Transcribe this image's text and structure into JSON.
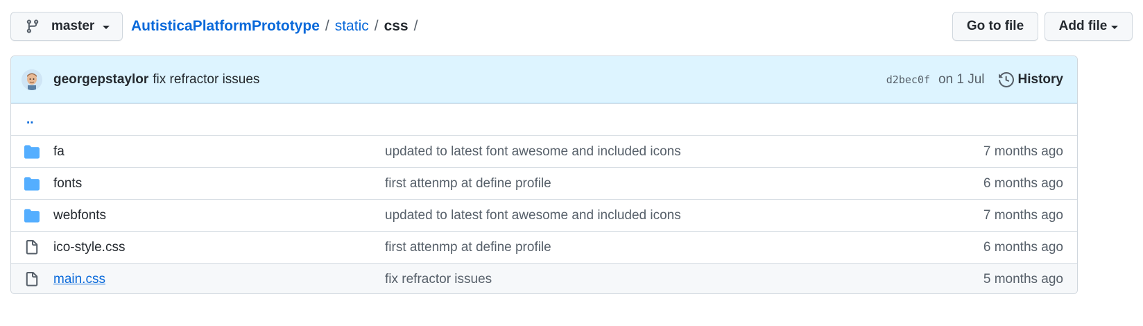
{
  "branch": {
    "name": "master",
    "icon": "git-branch-icon"
  },
  "breadcrumb": {
    "repo": "AutisticaPlatformPrototype",
    "sep": "/",
    "path": [
      "static",
      "css"
    ]
  },
  "actions": {
    "go_to_file": "Go to file",
    "add_file": "Add file"
  },
  "commit": {
    "author": "georgepstaylor",
    "message": "fix refractor issues",
    "sha": "d2bec0f",
    "date": "on 1 Jul",
    "history_label": "History"
  },
  "parent_link": "..",
  "files": [
    {
      "type": "folder",
      "name": "fa",
      "message": "updated to latest font awesome and included icons",
      "age": "7 months ago"
    },
    {
      "type": "folder",
      "name": "fonts",
      "message": "first attenmp at define profile",
      "age": "6 months ago"
    },
    {
      "type": "folder",
      "name": "webfonts",
      "message": "updated to latest font awesome and included icons",
      "age": "7 months ago"
    },
    {
      "type": "file",
      "name": "ico-style.css",
      "message": "first attenmp at define profile",
      "age": "6 months ago"
    },
    {
      "type": "file",
      "name": "main.css",
      "message": "fix refractor issues",
      "age": "5 months ago"
    }
  ],
  "colors": {
    "link": "#0969da",
    "folder": "#54aeff",
    "commit_bar": "#ddf4ff"
  }
}
